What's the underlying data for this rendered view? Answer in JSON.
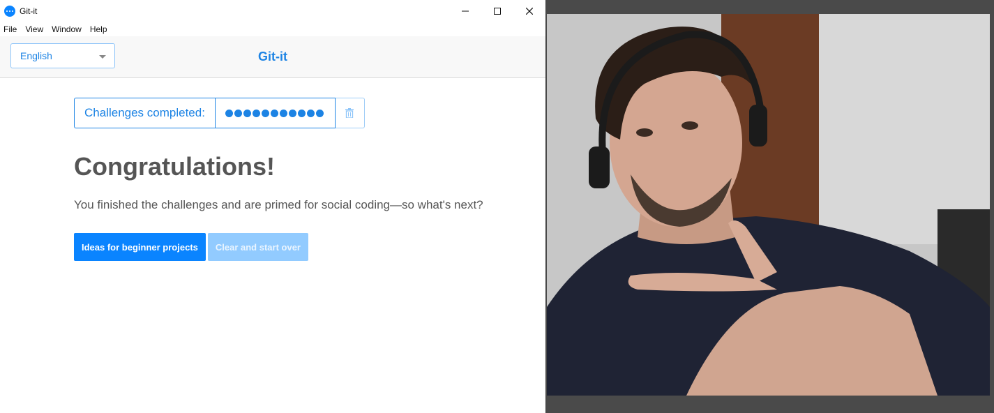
{
  "window": {
    "title": "Git-it",
    "controls": {
      "minimize": "minimize-icon",
      "maximize": "maximize-icon",
      "close": "close-icon"
    }
  },
  "menu": {
    "items": [
      "File",
      "View",
      "Window",
      "Help"
    ]
  },
  "header": {
    "language": "English",
    "title": "Git-it"
  },
  "progress": {
    "label": "Challenges completed:",
    "completed": 11,
    "total": 11
  },
  "main": {
    "heading": "Congratulations!",
    "message": "You finished the challenges and are primed for social coding—so what's next?",
    "primary_button": "Ideas for beginner projects",
    "secondary_button": "Clear and start over"
  },
  "colors": {
    "accent": "#1c83e4",
    "button_primary": "#0a84ff",
    "button_disabled": "#92cbff"
  }
}
